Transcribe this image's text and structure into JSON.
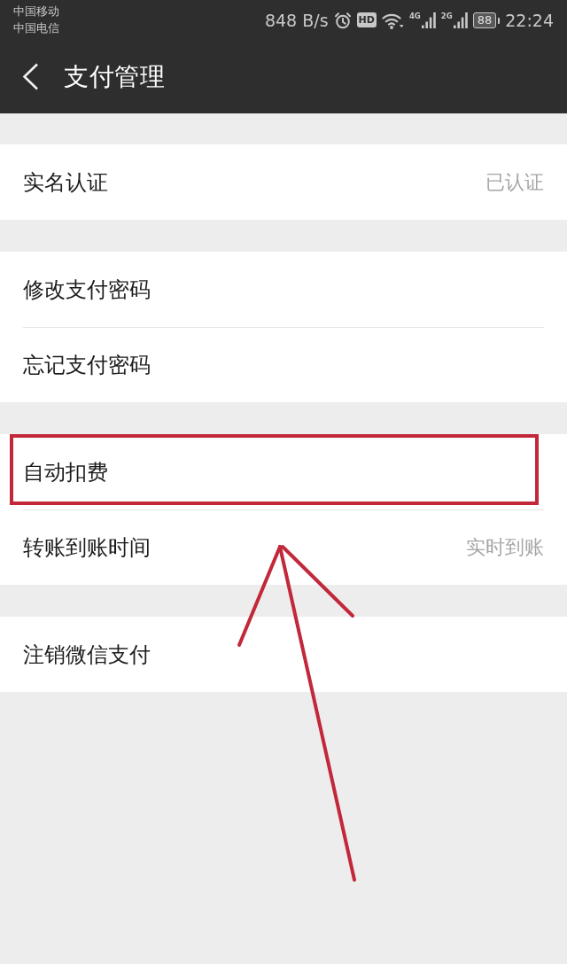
{
  "status_bar": {
    "carriers": [
      "中国移动",
      "中国电信"
    ],
    "network_speed": "848 B/s",
    "hd_badge": "HD",
    "signals": [
      {
        "label": "4G"
      },
      {
        "label": "2G"
      }
    ],
    "battery": "88",
    "time": "22:24"
  },
  "header": {
    "title": "支付管理"
  },
  "groups": [
    {
      "rows": [
        {
          "label": "实名认证",
          "value": "已认证",
          "highlighted": false
        }
      ]
    },
    {
      "rows": [
        {
          "label": "修改支付密码",
          "highlighted": false
        },
        {
          "label": "忘记支付密码",
          "highlighted": false
        }
      ]
    },
    {
      "rows": [
        {
          "label": "自动扣费",
          "highlighted": true
        },
        {
          "label": "转账到账时间",
          "value": "实时到账",
          "highlighted": false
        }
      ]
    },
    {
      "rows": [
        {
          "label": "注销微信支付",
          "highlighted": false
        }
      ]
    }
  ]
}
